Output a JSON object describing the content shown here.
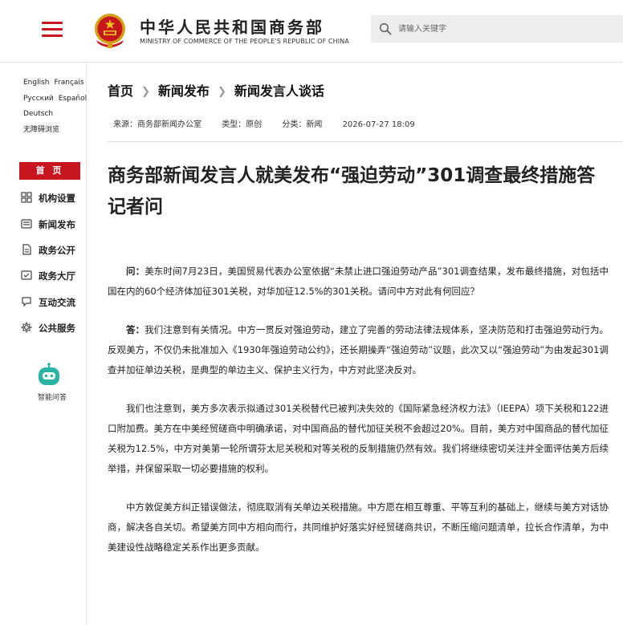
{
  "header": {
    "brand_cn": "中华人民共和国商务部",
    "brand_en": "MINISTRY OF COMMERCE OF THE PEOPLE'S REPUBLIC OF CHINA",
    "search_placeholder": "请输入关键字",
    "accent_color": "#c8161e"
  },
  "sidebar": {
    "languages": [
      [
        "English",
        "Français"
      ],
      [
        "Русский",
        "Español"
      ],
      [
        "Deutsch"
      ],
      [
        "无障碍浏览"
      ]
    ],
    "home_label": "首 页",
    "nav": [
      {
        "label": "机构设置",
        "icon": "org-grid-icon"
      },
      {
        "label": "新闻发布",
        "icon": "news-icon"
      },
      {
        "label": "政务公开",
        "icon": "document-icon"
      },
      {
        "label": "政务大厅",
        "icon": "hall-icon"
      },
      {
        "label": "互动交流",
        "icon": "chat-icon"
      },
      {
        "label": "公共服务",
        "icon": "service-icon"
      }
    ],
    "assistant_label": "智能问答"
  },
  "breadcrumb": [
    "首页",
    "新闻发布",
    "新闻发言人谈话"
  ],
  "meta": {
    "source": "来源：商务部新闻办公室",
    "type": "类型：原创",
    "category": "分类：新闻",
    "datetime": "2026-07-27 18:09"
  },
  "article": {
    "title": "商务部新闻发言人就美发布“强迫劳动”301调查最终措施答记者问",
    "question_lead": "问：",
    "question": "美东时间7月23日，美国贸易代表办公室依据“未禁止进口强迫劳动产品”301调查结果，发布最终措施，对包括中国在内的60个经济体加征301关税，对华加征12.5%的301关税。请问中方对此有何回应？",
    "answer_lead": "答：",
    "answer": "我们注意到有关情况。中方一贯反对强迫劳动，建立了完善的劳动法律法规体系，坚决防范和打击强迫劳动行为。反观美方，不仅仍未批准加入《1930年强迫劳动公约》，还长期操弄“强迫劳动”议题，此次又以“强迫劳动”为由发起301调查并加征单边关税，是典型的单边主义、保护主义行为，中方对此坚决反对。",
    "para3": "我们也注意到，美方多次表示拟通过301关税替代已被判决失效的《国际紧急经济权力法》（IEEPA）项下关税和122进口附加费。美方在中美经贸磋商中明确承诺，对中国商品的替代加征关税不会超过20%。目前，美方对中国商品的替代加征关税为12.5%，中方对美第一轮所谓芬太尼关税和对等关税的反制措施仍然有效。我们将继续密切关注并全面评估美方后续举措，并保留采取一切必要措施的权利。",
    "para4": "中方敦促美方纠正错误做法，彻底取消有关单边关税措施。中方愿在相互尊重、平等互利的基础上，继续与美方对话协商，解决各自关切。希望美方同中方相向而行，共同维护好落实好经贸磋商共识，不断压缩问题清单，拉长合作清单，为中美建设性战略稳定关系作出更多贡献。"
  }
}
